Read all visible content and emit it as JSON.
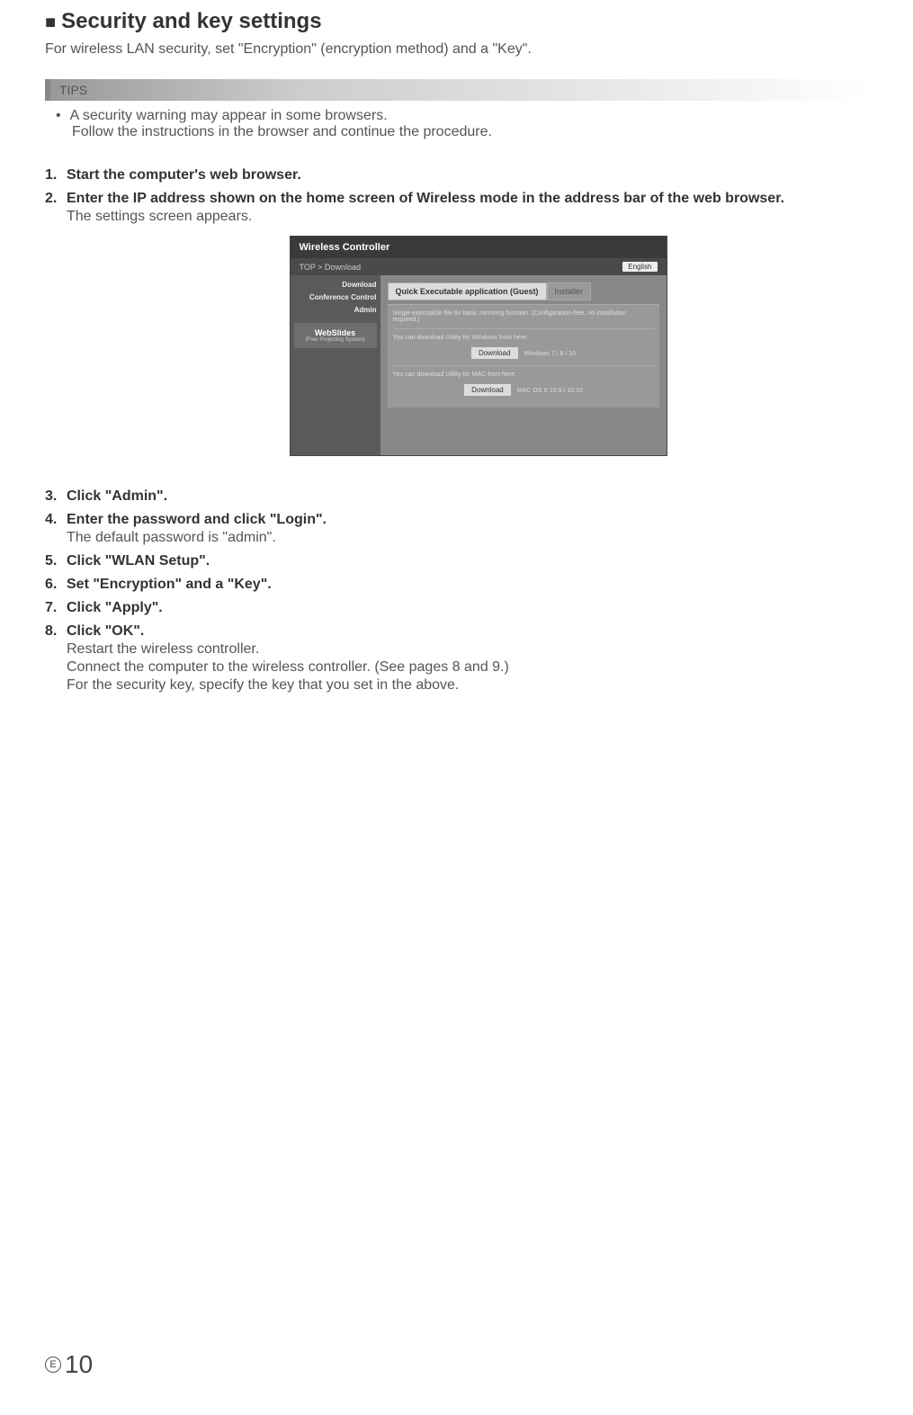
{
  "title": "Security and key settings",
  "intro": "For wireless LAN security, set \"Encryption\" (encryption method) and a \"Key\".",
  "tips": {
    "header": "TIPS",
    "line1": "A security warning may appear in some browsers.",
    "line2": "Follow the instructions in the browser and continue the procedure."
  },
  "steps": {
    "s1": {
      "num": "1.",
      "bold": "Start the computer's web browser."
    },
    "s2": {
      "num": "2.",
      "bold": "Enter the IP address shown on the home screen of Wireless mode in the address bar of the web browser.",
      "sub": "The settings screen appears."
    },
    "s3": {
      "num": "3.",
      "bold": "Click \"Admin\"."
    },
    "s4": {
      "num": "4.",
      "bold": "Enter the password and click \"Login\".",
      "sub": "The default password is \"admin\"."
    },
    "s5": {
      "num": "5.",
      "bold": "Click \"WLAN Setup\"."
    },
    "s6": {
      "num": "6.",
      "bold": "Set \"Encryption\" and a \"Key\"."
    },
    "s7": {
      "num": "7.",
      "bold": "Click \"Apply\"."
    },
    "s8": {
      "num": "8.",
      "bold": "Click \"OK\".",
      "sub1": "Restart the wireless controller.",
      "sub2": "Connect the computer to the wireless controller. (See pages 8 and 9.)",
      "sub3": "For the security key, specify the key that you set in the above."
    }
  },
  "screenshot": {
    "title": "Wireless Controller",
    "breadcrumb": "TOP > Download",
    "language": "English",
    "sidebar": {
      "download": "Download",
      "conference": "Conference Control",
      "admin": "Admin",
      "webslides": "WebSlides",
      "webslides_sub": "(Free Projecting System)"
    },
    "tabs": {
      "active": "Quick Executable application (Guest)",
      "inactive": "Installer"
    },
    "panel": {
      "desc": "Single executable file for basic mirroring function. (Configuration-free, no installation required.)",
      "win_text": "You can download Utility for Windows from here.",
      "download_btn": "Download",
      "win_os": "Windows 7 / 8 / 10",
      "mac_text": "You can download Utility for MAC from here.",
      "mac_os": "MAC OS X 10.9 / 10.10"
    }
  },
  "footer": {
    "e": "E",
    "page": "10"
  }
}
